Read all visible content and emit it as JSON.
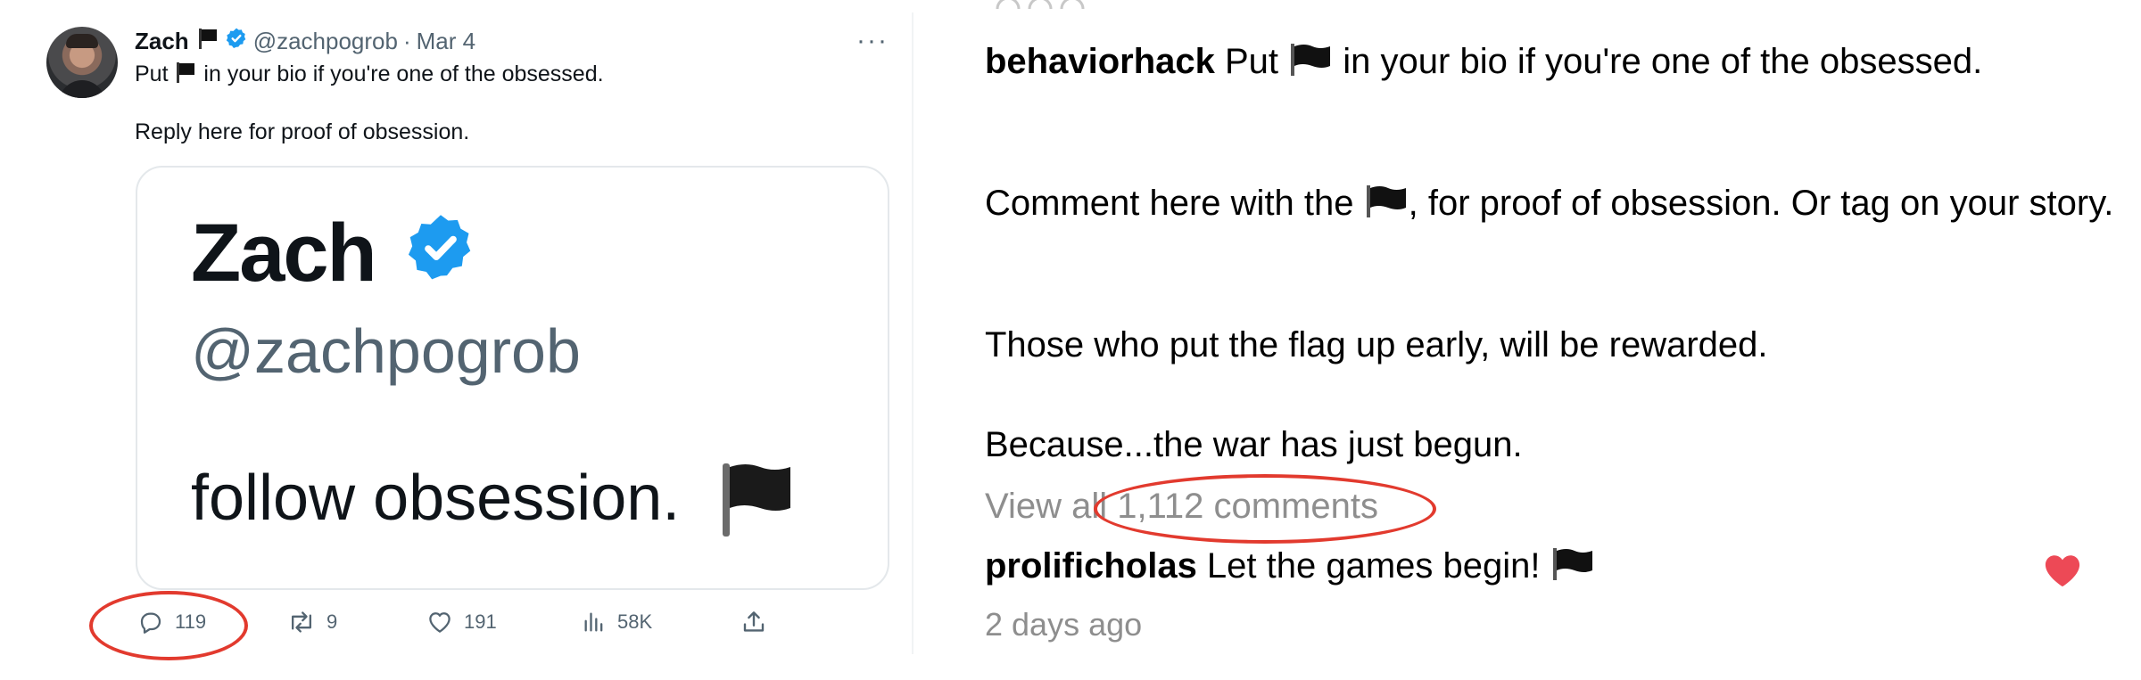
{
  "tweet": {
    "author_name": "Zach",
    "handle": "@zachpogrob",
    "date": "Mar 4",
    "separator": "·",
    "more_label": "···",
    "text_line1_before": "Put ",
    "text_line1_after": " in your bio if you're one of the obsessed.",
    "text_line2": "Reply here for proof of obsession.",
    "card": {
      "name": "Zach",
      "handle": "@zachpogrob",
      "follow_text": "follow obsession."
    },
    "actions": {
      "replies": "119",
      "retweets": "9",
      "likes": "191",
      "views": "58K"
    }
  },
  "post": {
    "username": "behaviorhack",
    "caption_line1_before": " Put ",
    "caption_line1_after": " in your bio if you're one of the obsessed.",
    "caption_para2_before": "Comment here with the ",
    "caption_para2_after": ", for proof of obsession. Or tag on your story.",
    "caption_para3": "Those who put the flag up early, will be rewarded.",
    "caption_para4": "Because...the war has just begun.",
    "view_all": "View all 1,112 comments",
    "comment": {
      "username": "prolificholas",
      "text": " Let the games begin! "
    },
    "time_ago": "2 days ago"
  },
  "colors": {
    "verified_blue": "#1d9bf0",
    "annotation_red": "#e23a2e",
    "heart_red": "#ed4956",
    "muted_text": "#536471",
    "ig_muted": "#8e8e8e"
  },
  "icons": [
    "black-flag-icon",
    "verified-badge-icon",
    "more-icon",
    "reply-icon",
    "retweet-icon",
    "like-icon",
    "views-icon",
    "share-icon",
    "heart-icon"
  ]
}
